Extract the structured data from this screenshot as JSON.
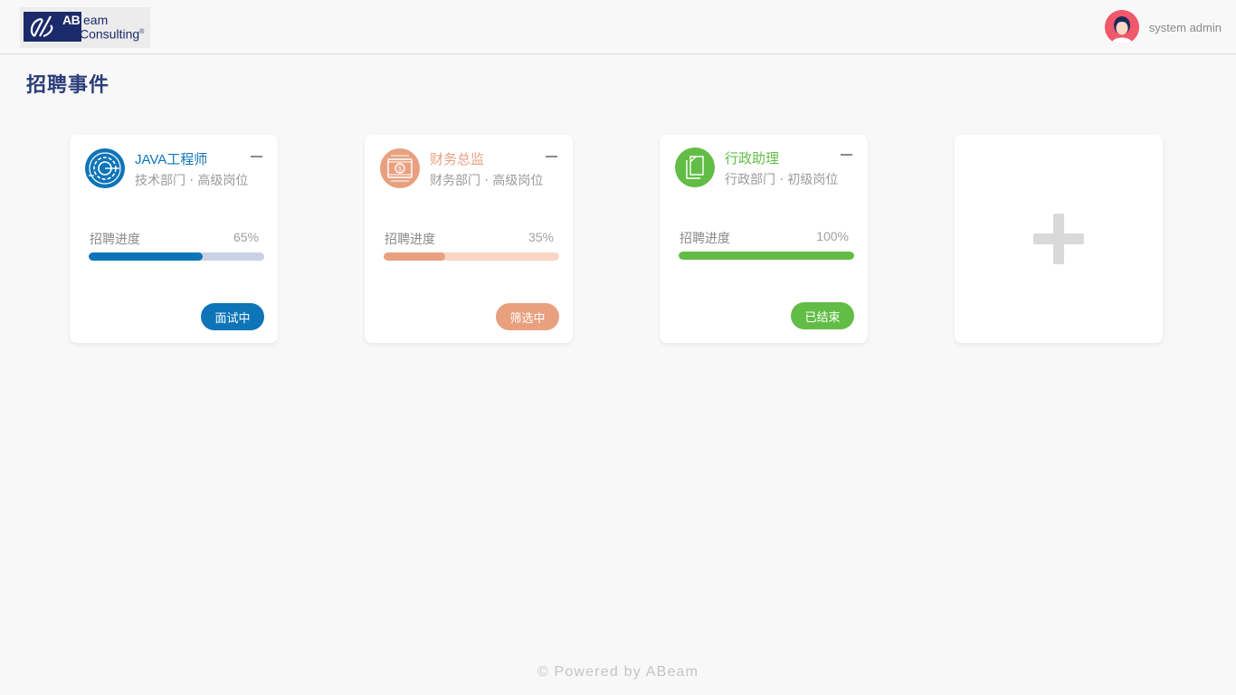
{
  "header": {
    "logo": {
      "mark_text": "AB",
      "line1": "eam",
      "line2": "Consulting",
      "trademark": "®"
    },
    "user_name": "system admin"
  },
  "page_title": "招聘事件",
  "progress_label": "招聘进度",
  "colors": {
    "blue": "#0d74b8",
    "orange": "#e8a07f",
    "green": "#62bd46",
    "navy": "#1b2a6b"
  },
  "cards": [
    {
      "icon": "gear-icon",
      "title": "JAVA工程师",
      "subtitle": "技术部门 · 高级岗位",
      "progress_text": "65%",
      "progress": 0.65,
      "status": "面试中",
      "accent": "#0d74b8",
      "track": "#c9d2e4"
    },
    {
      "icon": "money-icon",
      "title": "财务总监",
      "subtitle": "财务部门 · 高级岗位",
      "progress_text": "35%",
      "progress": 0.35,
      "status": "筛选中",
      "accent": "#e8a07f",
      "track": "#fad6c4"
    },
    {
      "icon": "document-icon",
      "title": "行政助理",
      "subtitle": "行政部门 · 初级岗位",
      "progress_text": "100%",
      "progress": 1.0,
      "status": "已结束",
      "accent": "#62bd46",
      "track": "#cdeabf"
    }
  ],
  "add_card_icon": "plus-icon",
  "footer": "© Powered by ABeam"
}
